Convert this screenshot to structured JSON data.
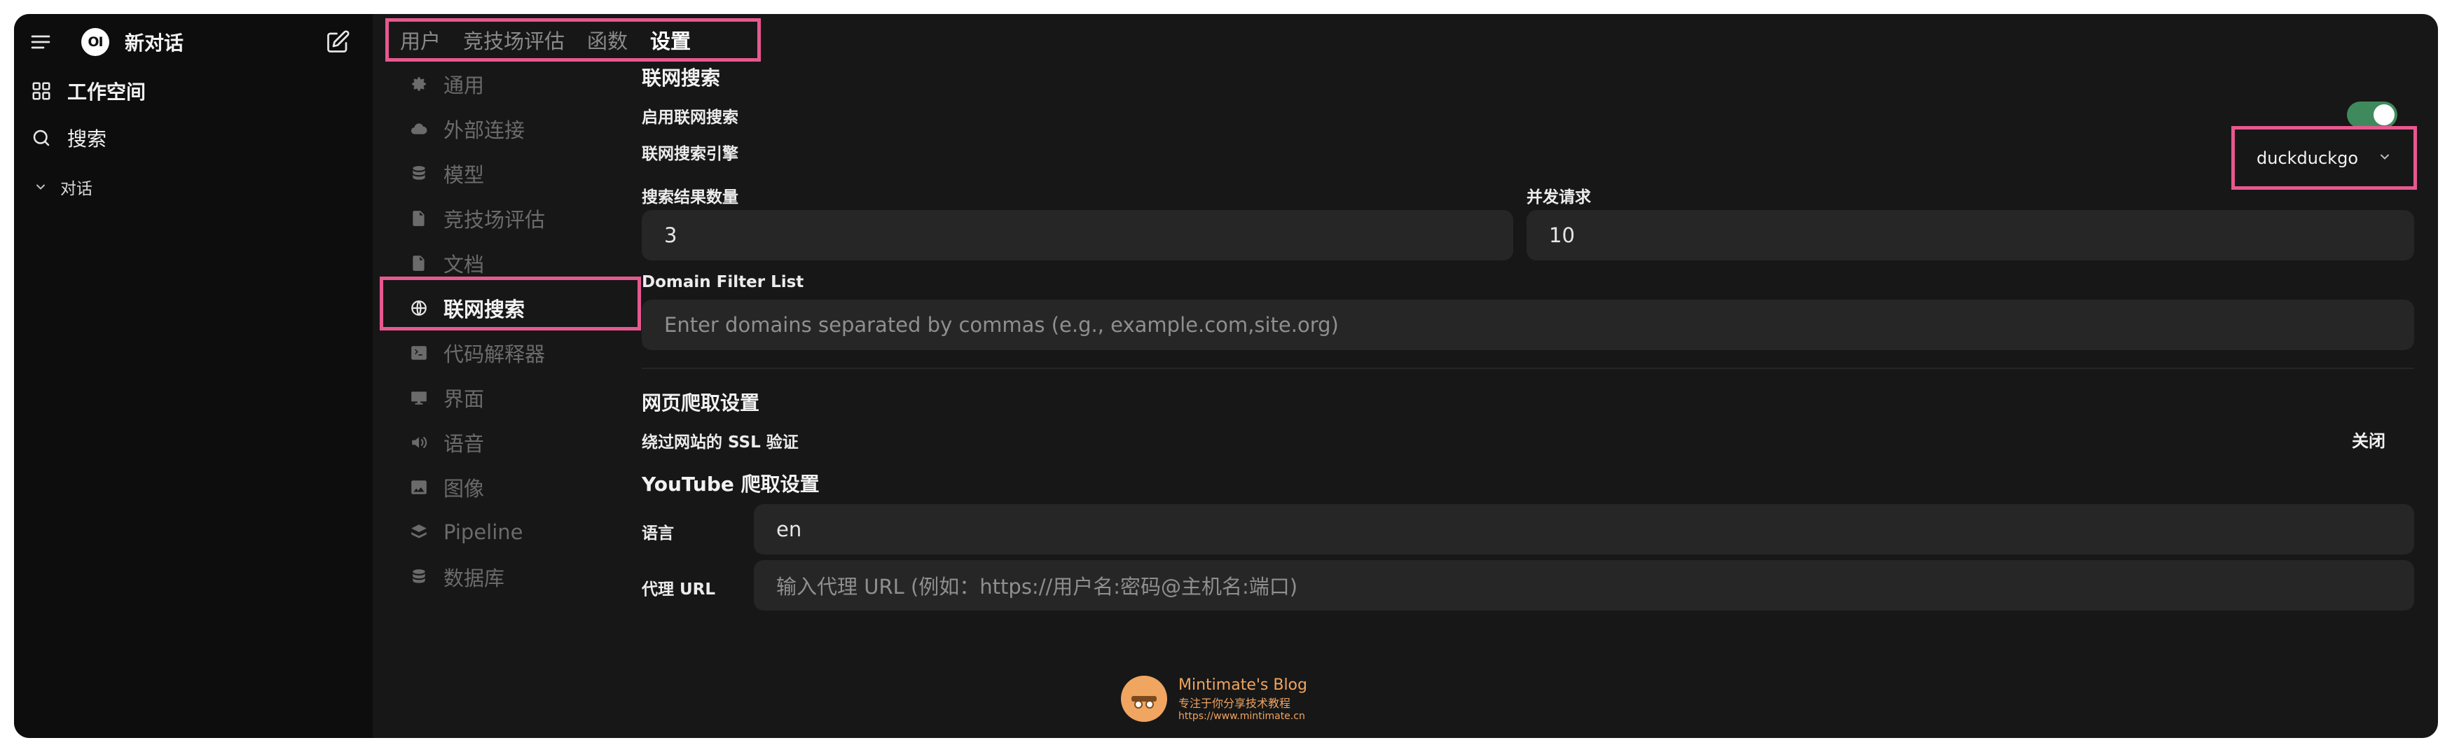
{
  "sidebar": {
    "new_chat": "新对话",
    "logo_text": "OI",
    "workspace": "工作空间",
    "search": "搜索",
    "chats_section": "对话"
  },
  "admin_tabs": [
    {
      "label": "用户",
      "active": false
    },
    {
      "label": "竞技场评估",
      "active": false
    },
    {
      "label": "函数",
      "active": false
    },
    {
      "label": "设置",
      "active": true
    }
  ],
  "settings_nav": [
    {
      "label": "通用",
      "icon": "gear-icon"
    },
    {
      "label": "外部连接",
      "icon": "cloud-icon"
    },
    {
      "label": "模型",
      "icon": "database-icon"
    },
    {
      "label": "竞技场评估",
      "icon": "document-icon"
    },
    {
      "label": "文档",
      "icon": "document-icon"
    },
    {
      "label": "联网搜索",
      "icon": "globe-icon",
      "active": true
    },
    {
      "label": "代码解释器",
      "icon": "terminal-icon"
    },
    {
      "label": "界面",
      "icon": "monitor-icon"
    },
    {
      "label": "语音",
      "icon": "speaker-icon"
    },
    {
      "label": "图像",
      "icon": "image-icon"
    },
    {
      "label": "Pipeline",
      "icon": "layers-icon"
    },
    {
      "label": "数据库",
      "icon": "database-icon"
    }
  ],
  "web_search": {
    "title": "联网搜索",
    "enable_label": "启用联网搜索",
    "enabled": true,
    "engine_label": "联网搜索引擎",
    "engine_value": "duckduckgo",
    "result_count_label": "搜索结果数量",
    "result_count_value": "3",
    "concurrent_label": "并发请求",
    "concurrent_value": "10",
    "domain_filter_label": "Domain Filter List",
    "domain_filter_placeholder": "Enter domains separated by commas (e.g., example.com,site.org)"
  },
  "crawl": {
    "title": "网页爬取设置",
    "ssl_label": "绕过网站的 SSL 验证",
    "ssl_value": "关闭"
  },
  "youtube": {
    "title": "YouTube 爬取设置",
    "language_label": "语言",
    "language_value": "en",
    "proxy_label": "代理 URL",
    "proxy_placeholder": "输入代理 URL (例如：https://用户名:密码@主机名:端口)"
  },
  "watermark": {
    "title": "Mintimate's Blog",
    "subtitle": "专注于你分享技术教程",
    "url": "https://www.mintimate.cn"
  },
  "colors": {
    "highlight": "#e7588f",
    "toggle_on": "#3f8a5c",
    "background": "#171717",
    "sidebar": "#0d0d0d"
  }
}
